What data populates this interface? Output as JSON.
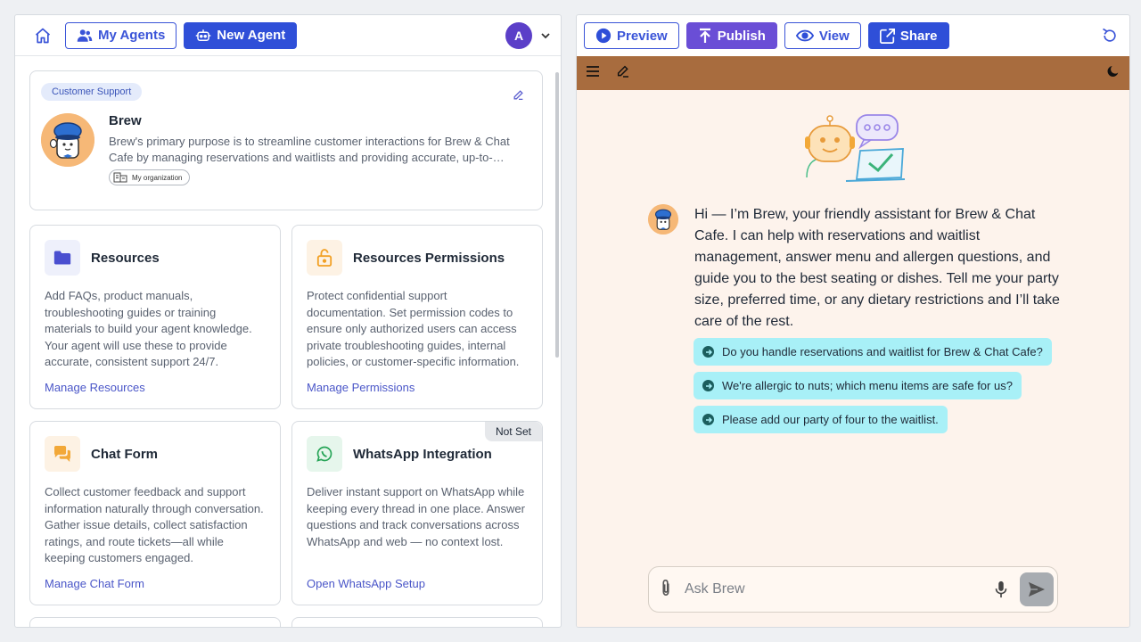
{
  "left_header": {
    "my_agents_label": "My Agents",
    "new_agent_label": "New Agent",
    "avatar_letter": "A"
  },
  "agent": {
    "tag": "Customer Support",
    "name": "Brew",
    "description": "Brew's primary purpose is to streamline customer interactions for Brew & Chat Cafe by managing reservations and waitlists and providing accurate, up-to-…",
    "org_label": "My organization"
  },
  "cards": [
    {
      "title": "Resources",
      "description": "Add FAQs, product manuals, troubleshooting guides or training materials to build your agent knowledge. Your agent will use these to provide accurate, consistent support 24/7.",
      "link": "Manage Resources"
    },
    {
      "title": "Resources Permissions",
      "description": "Protect confidential support documentation. Set permission codes to ensure only authorized users can access private troubleshooting guides, internal policies, or customer-specific information.",
      "link": "Manage Permissions"
    },
    {
      "title": "Chat Form",
      "description": "Collect customer feedback and support information naturally through conversation. Gather issue details, collect satisfaction ratings, and route tickets—all while keeping customers engaged.",
      "link": "Manage Chat Form"
    },
    {
      "title": "WhatsApp Integration",
      "badge": "Not Set",
      "description": "Deliver instant support on WhatsApp while keeping every thread in one place. Answer questions and track conversations across WhatsApp and web — no context lost.",
      "link": "Open WhatsApp Setup"
    }
  ],
  "right_header": {
    "preview_label": "Preview",
    "publish_label": "Publish",
    "view_label": "View",
    "share_label": "Share"
  },
  "chat": {
    "greeting": "Hi — I’m Brew, your friendly assistant for Brew & Chat Cafe. I can help with reservations and waitlist management, answer menu and allergen questions, and guide you to the best seating or dishes. Tell me your party size, preferred time, or any dietary restrictions and I’ll take care of the rest.",
    "suggestions": [
      "Do you handle reservations and waitlist for Brew & Chat Cafe?",
      "We're allergic to nuts; which menu items are safe for us?",
      "Please add our party of four to the waitlist."
    ],
    "input_placeholder": "Ask Brew"
  },
  "colors": {
    "primary": "#2f4fd8",
    "publish": "#6a4ed6",
    "app_bar": "#a86c3e",
    "chat_bg": "#fdf3ec",
    "suggestion_bg": "#a8f0f7"
  }
}
